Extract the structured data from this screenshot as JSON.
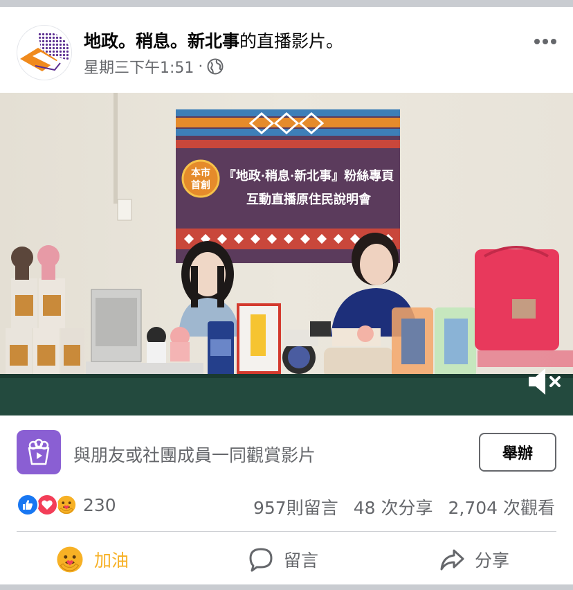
{
  "post": {
    "page_name": "地政。稍息。新北事",
    "title_suffix": "的直播影片。",
    "timestamp": "星期三下午1:51",
    "dot": "·"
  },
  "video": {
    "banner_badge": "本市首創",
    "banner_line1": "『地政·稍息·新北事』粉絲專頁",
    "banner_line2": "互動直播原住民說明會"
  },
  "watch_together": {
    "text": "與朋友或社團成員一同觀賞影片",
    "button_label": "舉辦"
  },
  "stats": {
    "reaction_count": "230",
    "comments": "957則留言",
    "shares": "48 次分享",
    "views": "2,704 次觀看"
  },
  "actions": {
    "cheer_label": "加油",
    "comment_label": "留言",
    "share_label": "分享"
  },
  "colors": {
    "secondary_text": "#65676b",
    "like_blue": "#1877f2",
    "love_red": "#f33e58",
    "cheer_yellow": "#f7b125",
    "watch_purple": "#8a5fd3"
  },
  "icons": [
    "more-icon",
    "globe-icon",
    "mute-icon",
    "watch-party-icon",
    "like-reaction-icon",
    "love-reaction-icon",
    "care-reaction-icon",
    "comment-icon",
    "share-icon"
  ]
}
